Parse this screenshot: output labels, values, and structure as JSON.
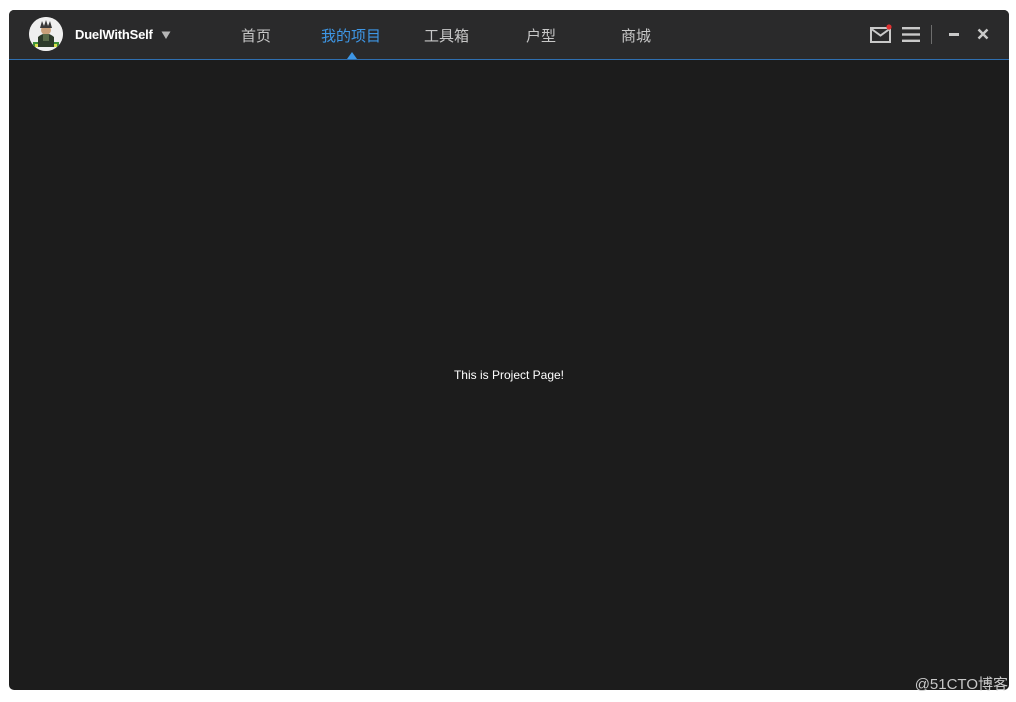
{
  "header": {
    "username": "DuelWithSelf",
    "tabs": [
      {
        "label": "首页",
        "active": false
      },
      {
        "label": "我的项目",
        "active": true
      },
      {
        "label": "工具箱",
        "active": false
      },
      {
        "label": "户型",
        "active": false
      },
      {
        "label": "商城",
        "active": false
      }
    ],
    "icons": [
      "avatar",
      "dropdown-caret-icon",
      "mail-icon",
      "menu-icon",
      "minimize-icon",
      "close-icon"
    ],
    "notification_dot": true
  },
  "main": {
    "message": "This is Project Page!"
  },
  "watermark": "@51CTO博客",
  "colors": {
    "background": "#1c1c1c",
    "titlebar": "#2a2a2b",
    "accent": "#3e97e6",
    "notification": "#e03030"
  }
}
